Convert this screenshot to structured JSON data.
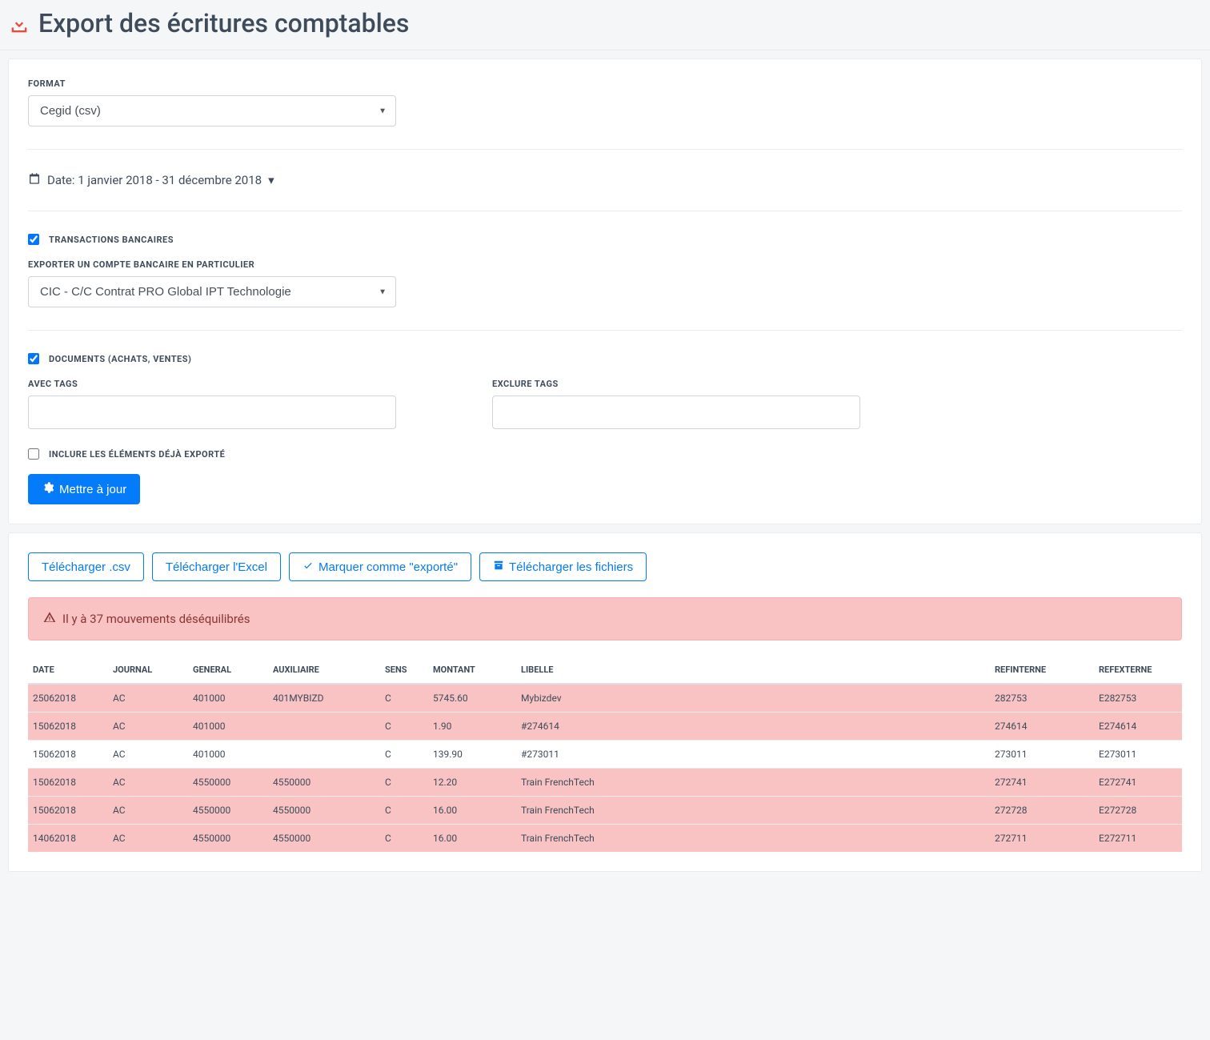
{
  "header": {
    "title": "Export des écritures comptables"
  },
  "form": {
    "format_label": "FORMAT",
    "format_value": "Cegid (csv)",
    "date_label": "Date: 1 janvier 2018 - 31 décembre 2018",
    "transactions_label": "TRANSACTIONS BANCAIRES",
    "transactions_checked": true,
    "bank_account_label": "EXPORTER UN COMPTE BANCAIRE EN PARTICULIER",
    "bank_account_value": "CIC - C/C Contrat PRO Global IPT Technologie",
    "documents_label": "DOCUMENTS (ACHATS, VENTES)",
    "documents_checked": true,
    "with_tags_label": "AVEC TAGS",
    "exclude_tags_label": "EXCLURE TAGS",
    "include_exported_label": "INCLURE LES ÉLÉMENTS DÉJÀ EXPORTÉ",
    "include_exported_checked": false,
    "update_button": "Mettre à jour"
  },
  "actions": {
    "download_csv": "Télécharger .csv",
    "download_excel": "Télécharger l'Excel",
    "mark_exported": "Marquer comme \"exporté\"",
    "download_files": "Télécharger les fichiers"
  },
  "alert": {
    "text": "Il y à 37 mouvements déséquilibrés"
  },
  "table": {
    "headers": {
      "date": "DATE",
      "journal": "JOURNAL",
      "general": "GENERAL",
      "auxiliaire": "AUXILIAIRE",
      "sens": "SENS",
      "montant": "MONTANT",
      "libelle": "LIBELLE",
      "refinterne": "REFINTERNE",
      "refexterne": "REFEXTERNE"
    },
    "rows": [
      {
        "date": "25062018",
        "journal": "AC",
        "general": "401000",
        "auxiliaire": "401MYBIZD",
        "sens": "C",
        "montant": "5745.60",
        "libelle": "Mybizdev",
        "refinterne": "282753",
        "refexterne": "E282753",
        "danger": true
      },
      {
        "date": "15062018",
        "journal": "AC",
        "general": "401000",
        "auxiliaire": "",
        "sens": "C",
        "montant": "1.90",
        "libelle": "#274614",
        "refinterne": "274614",
        "refexterne": "E274614",
        "danger": true
      },
      {
        "date": "15062018",
        "journal": "AC",
        "general": "401000",
        "auxiliaire": "",
        "sens": "C",
        "montant": "139.90",
        "libelle": "#273011",
        "refinterne": "273011",
        "refexterne": "E273011",
        "danger": false
      },
      {
        "date": "15062018",
        "journal": "AC",
        "general": "4550000",
        "auxiliaire": "4550000",
        "sens": "C",
        "montant": "12.20",
        "libelle": "Train FrenchTech",
        "refinterne": "272741",
        "refexterne": "E272741",
        "danger": true
      },
      {
        "date": "15062018",
        "journal": "AC",
        "general": "4550000",
        "auxiliaire": "4550000",
        "sens": "C",
        "montant": "16.00",
        "libelle": "Train FrenchTech",
        "refinterne": "272728",
        "refexterne": "E272728",
        "danger": true
      },
      {
        "date": "14062018",
        "journal": "AC",
        "general": "4550000",
        "auxiliaire": "4550000",
        "sens": "C",
        "montant": "16.00",
        "libelle": "Train FrenchTech",
        "refinterne": "272711",
        "refexterne": "E272711",
        "danger": true
      }
    ]
  }
}
